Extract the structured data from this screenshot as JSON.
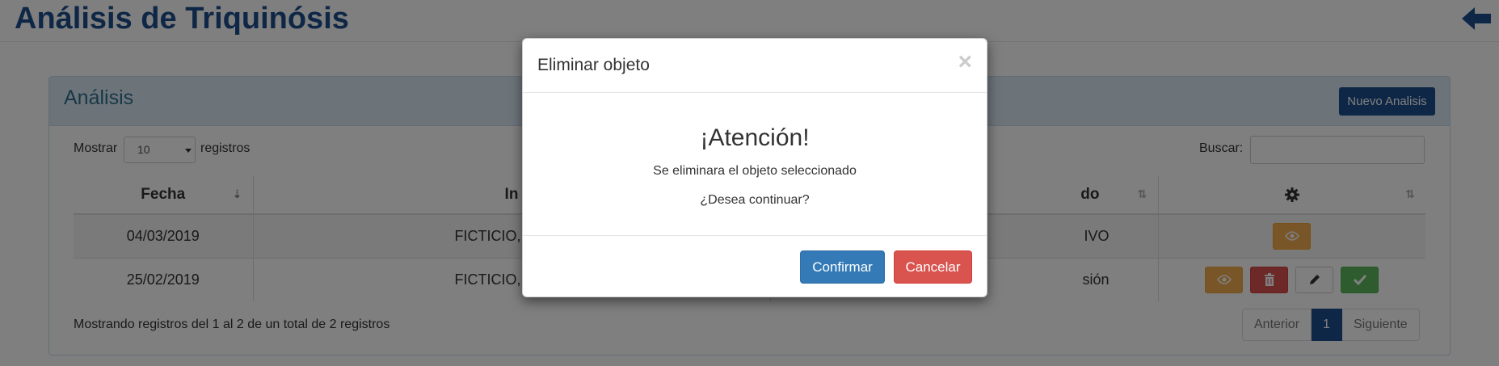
{
  "page": {
    "title": "Análisis de Triquinósis"
  },
  "panel": {
    "title": "Análisis",
    "new_button": "Nuevo Analisis"
  },
  "controls": {
    "show_label": "Mostrar",
    "page_size": "10",
    "records_label": "registros",
    "search_label": "Buscar:"
  },
  "table": {
    "columns": [
      "Fecha",
      "In",
      "do",
      "gear-icon"
    ],
    "rows": [
      {
        "fecha": "04/03/2019",
        "interesado": "FICTICIO, NOMB",
        "estado": "IVO",
        "actions": [
          "view"
        ]
      },
      {
        "fecha": "25/02/2019",
        "interesado": "FICTICIO, NOMB",
        "estado": "sión",
        "actions": [
          "view",
          "delete",
          "edit",
          "confirm"
        ]
      }
    ]
  },
  "footer": {
    "info": "Mostrando registros del 1 al 2 de un total de 2 registros",
    "prev": "Anterior",
    "page": "1",
    "next": "Siguiente"
  },
  "modal": {
    "title": "Eliminar objeto",
    "close": "×",
    "heading": "¡Atención!",
    "message": "Se eliminara el objeto seleccionado",
    "question": "¿Desea continuar?",
    "confirm": "Confirmar",
    "cancel": "Cancelar"
  },
  "colors": {
    "primary": "#1f4e8c",
    "panel_heading": "#d9e8f5",
    "warning": "#f0ad4e",
    "danger": "#d9534f",
    "success": "#5cb85c",
    "confirm": "#337ab7"
  }
}
